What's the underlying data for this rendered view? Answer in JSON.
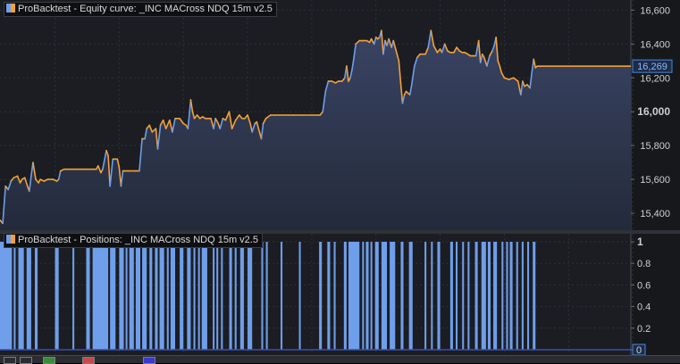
{
  "equity_panel": {
    "title": "ProBacktest - Equity curve: _INC MACross NDQ 15m v2.5",
    "current_value_label": "16,269"
  },
  "positions_panel": {
    "title": "ProBacktest - Positions: _INC MACross NDQ 15m v2.5",
    "current_value_label": "0"
  },
  "colors": {
    "background": "#1b1d22",
    "area_fill_top": "#3a4464",
    "area_fill_bottom": "#232a3a",
    "flat_line": "#f4a137",
    "rising_line": "#6f9eea",
    "position_bar": "#6f9eea",
    "label_box": "#4f86d6"
  },
  "chart_data": [
    {
      "type": "area",
      "title": "ProBacktest - Equity curve: _INC MACross NDQ 15m v2.5",
      "xlabel": "",
      "ylabel": "",
      "ylim": [
        15300,
        16660
      ],
      "grid": true,
      "y_ticks": [
        15400,
        15600,
        15800,
        16000,
        16200,
        16400,
        16600
      ],
      "y_tick_labels": [
        "15,400",
        "15,600",
        "15,800",
        "16,000",
        "16,200",
        "16,400",
        "16,600"
      ],
      "last_value": 16269,
      "x_index_range": [
        0,
        688
      ],
      "series": [
        {
          "points": [
            [
              0,
              15360
            ],
            [
              3,
              15340
            ],
            [
              6,
              15560
            ],
            [
              9,
              15540
            ],
            [
              12,
              15590
            ],
            [
              15,
              15610
            ],
            [
              19,
              15620
            ],
            [
              22,
              15580
            ],
            [
              24,
              15600
            ],
            [
              27,
              15610
            ],
            [
              30,
              15560
            ],
            [
              32,
              15530
            ],
            [
              34,
              15620
            ],
            [
              36,
              15700
            ],
            [
              39,
              15600
            ],
            [
              42,
              15580
            ],
            [
              44,
              15600
            ],
            [
              48,
              15590
            ],
            [
              52,
              15600
            ],
            [
              58,
              15600
            ],
            [
              62,
              15590
            ],
            [
              64,
              15600
            ],
            [
              66,
              15650
            ],
            [
              70,
              15660
            ],
            [
              80,
              15660
            ],
            [
              90,
              15660
            ],
            [
              100,
              15660
            ],
            [
              105,
              15660
            ],
            [
              107,
              15680
            ],
            [
              110,
              15640
            ],
            [
              112,
              15660
            ],
            [
              116,
              15770
            ],
            [
              118,
              15740
            ],
            [
              120,
              15560
            ],
            [
              123,
              15720
            ],
            [
              125,
              15720
            ],
            [
              128,
              15720
            ],
            [
              130,
              15670
            ],
            [
              132,
              15560
            ],
            [
              134,
              15650
            ],
            [
              136,
              15650
            ],
            [
              140,
              15650
            ],
            [
              148,
              15650
            ],
            [
              152,
              15650
            ],
            [
              155,
              15840
            ],
            [
              158,
              15840
            ],
            [
              160,
              15900
            ],
            [
              163,
              15920
            ],
            [
              166,
              15880
            ],
            [
              170,
              15900
            ],
            [
              172,
              15780
            ],
            [
              175,
              15920
            ],
            [
              178,
              15950
            ],
            [
              181,
              15900
            ],
            [
              185,
              15950
            ],
            [
              188,
              15880
            ],
            [
              191,
              15960
            ],
            [
              196,
              15960
            ],
            [
              200,
              15930
            ],
            [
              203,
              15920
            ],
            [
              205,
              15900
            ],
            [
              208,
              16070
            ],
            [
              210,
              16000
            ],
            [
              212,
              15960
            ],
            [
              215,
              15980
            ],
            [
              218,
              15960
            ],
            [
              221,
              15970
            ],
            [
              224,
              15960
            ],
            [
              226,
              15960
            ],
            [
              230,
              15960
            ],
            [
              233,
              15900
            ],
            [
              235,
              15960
            ],
            [
              238,
              15930
            ],
            [
              240,
              15900
            ],
            [
              243,
              15960
            ],
            [
              246,
              15950
            ],
            [
              250,
              16000
            ],
            [
              253,
              15900
            ],
            [
              257,
              15950
            ],
            [
              261,
              15980
            ],
            [
              264,
              15960
            ],
            [
              267,
              15960
            ],
            [
              270,
              15980
            ],
            [
              273,
              15930
            ],
            [
              275,
              15880
            ],
            [
              278,
              15930
            ],
            [
              280,
              15940
            ],
            [
              283,
              15880
            ],
            [
              285,
              15840
            ],
            [
              287,
              15930
            ],
            [
              290,
              15960
            ],
            [
              295,
              15980
            ],
            [
              300,
              15980
            ],
            [
              305,
              15980
            ],
            [
              310,
              15980
            ],
            [
              315,
              15980
            ],
            [
              320,
              15980
            ],
            [
              330,
              15980
            ],
            [
              340,
              15980
            ],
            [
              345,
              15980
            ],
            [
              349,
              15980
            ],
            [
              352,
              16000
            ],
            [
              355,
              16120
            ],
            [
              358,
              16180
            ],
            [
              362,
              16180
            ],
            [
              366,
              16170
            ],
            [
              369,
              16180
            ],
            [
              373,
              16180
            ],
            [
              376,
              16200
            ],
            [
              378,
              16270
            ],
            [
              380,
              16180
            ],
            [
              382,
              16200
            ],
            [
              384,
              16250
            ],
            [
              386,
              16320
            ],
            [
              388,
              16400
            ],
            [
              392,
              16420
            ],
            [
              396,
              16420
            ],
            [
              400,
              16420
            ],
            [
              403,
              16410
            ],
            [
              405,
              16430
            ],
            [
              408,
              16400
            ],
            [
              410,
              16440
            ],
            [
              412,
              16430
            ],
            [
              414,
              16440
            ],
            [
              416,
              16480
            ],
            [
              418,
              16340
            ],
            [
              420,
              16420
            ],
            [
              422,
              16390
            ],
            [
              424,
              16430
            ],
            [
              427,
              16380
            ],
            [
              429,
              16420
            ],
            [
              431,
              16380
            ],
            [
              433,
              16340
            ],
            [
              435,
              16300
            ],
            [
              437,
              16170
            ],
            [
              439,
              16050
            ],
            [
              441,
              16100
            ],
            [
              443,
              16120
            ],
            [
              445,
              16110
            ],
            [
              447,
              16100
            ],
            [
              449,
              16160
            ],
            [
              452,
              16270
            ],
            [
              455,
              16320
            ],
            [
              458,
              16340
            ],
            [
              461,
              16340
            ],
            [
              464,
              16340
            ],
            [
              467,
              16380
            ],
            [
              470,
              16480
            ],
            [
              473,
              16390
            ],
            [
              477,
              16350
            ],
            [
              480,
              16370
            ],
            [
              482,
              16350
            ],
            [
              485,
              16400
            ],
            [
              488,
              16360
            ],
            [
              491,
              16350
            ],
            [
              495,
              16350
            ],
            [
              498,
              16380
            ],
            [
              501,
              16360
            ],
            [
              504,
              16350
            ],
            [
              507,
              16350
            ],
            [
              510,
              16340
            ],
            [
              513,
              16330
            ],
            [
              516,
              16330
            ],
            [
              519,
              16330
            ],
            [
              522,
              16420
            ],
            [
              524,
              16290
            ],
            [
              526,
              16340
            ],
            [
              528,
              16320
            ],
            [
              531,
              16270
            ],
            [
              534,
              16330
            ],
            [
              537,
              16360
            ],
            [
              539,
              16390
            ],
            [
              541,
              16440
            ],
            [
              543,
              16300
            ],
            [
              545,
              16270
            ],
            [
              547,
              16230
            ],
            [
              550,
              16200
            ],
            [
              555,
              16190
            ],
            [
              560,
              16200
            ],
            [
              565,
              16180
            ],
            [
              568,
              16100
            ],
            [
              570,
              16180
            ],
            [
              572,
              16150
            ],
            [
              575,
              16160
            ],
            [
              578,
              16140
            ],
            [
              580,
              16230
            ],
            [
              582,
              16310
            ],
            [
              584,
              16260
            ],
            [
              586,
              16269
            ],
            [
              600,
              16269
            ],
            [
              620,
              16269
            ],
            [
              640,
              16269
            ],
            [
              660,
              16269
            ],
            [
              688,
              16269
            ]
          ]
        }
      ]
    },
    {
      "type": "bar",
      "title": "ProBacktest - Positions: _INC MACross NDQ 15m v2.5",
      "xlabel": "",
      "ylabel": "",
      "ylim": [
        0,
        1
      ],
      "grid": true,
      "y_ticks": [
        0,
        0.2,
        0.4,
        0.6,
        0.8,
        1
      ],
      "y_tick_labels": [
        "0",
        "0.2",
        "0.4",
        "0.6",
        "0.8",
        "1"
      ],
      "x_index_range": [
        0,
        688
      ],
      "in_position_intervals": [
        [
          0,
          13
        ],
        [
          15,
          17
        ],
        [
          20,
          26
        ],
        [
          29,
          34
        ],
        [
          38,
          41
        ],
        [
          60,
          64
        ],
        [
          79,
          81
        ],
        [
          94,
          98
        ],
        [
          101,
          118
        ],
        [
          120,
          126
        ],
        [
          130,
          135
        ],
        [
          137,
          139
        ],
        [
          141,
          146
        ],
        [
          148,
          153
        ],
        [
          155,
          160
        ],
        [
          163,
          166
        ],
        [
          169,
          172
        ],
        [
          174,
          179
        ],
        [
          182,
          184
        ],
        [
          186,
          191
        ],
        [
          196,
          200
        ],
        [
          204,
          208
        ],
        [
          211,
          213
        ],
        [
          216,
          218
        ],
        [
          220,
          226
        ],
        [
          232,
          234
        ],
        [
          236,
          238
        ],
        [
          241,
          243
        ],
        [
          250,
          253
        ],
        [
          256,
          258
        ],
        [
          262,
          266
        ],
        [
          270,
          275
        ],
        [
          285,
          287
        ],
        [
          290,
          292
        ],
        [
          306,
          308
        ],
        [
          326,
          328
        ],
        [
          348,
          351
        ],
        [
          357,
          360
        ],
        [
          364,
          366
        ],
        [
          375,
          378
        ],
        [
          380,
          392
        ],
        [
          395,
          397
        ],
        [
          399,
          402
        ],
        [
          404,
          406
        ],
        [
          409,
          413
        ],
        [
          416,
          422
        ],
        [
          425,
          431
        ],
        [
          437,
          440
        ],
        [
          446,
          450
        ],
        [
          463,
          465
        ],
        [
          470,
          472
        ],
        [
          477,
          480
        ],
        [
          491,
          494
        ],
        [
          497,
          499
        ],
        [
          504,
          506
        ],
        [
          510,
          512
        ],
        [
          518,
          521
        ],
        [
          525,
          530
        ],
        [
          532,
          535
        ],
        [
          538,
          542
        ],
        [
          547,
          549
        ],
        [
          552,
          554
        ],
        [
          556,
          559
        ],
        [
          563,
          565
        ],
        [
          569,
          571
        ],
        [
          575,
          577
        ],
        [
          581,
          584
        ]
      ]
    }
  ]
}
